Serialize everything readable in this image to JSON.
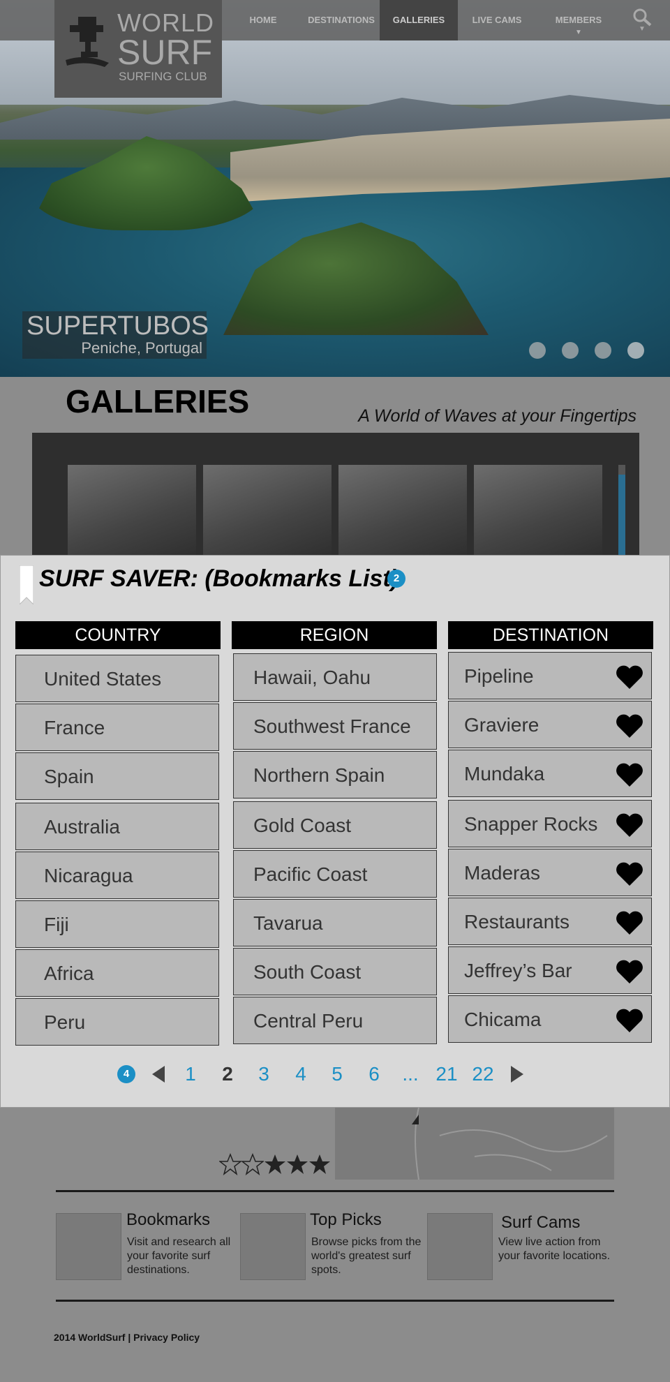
{
  "logo": {
    "line1": "WORLD",
    "line2": "SURF",
    "line3": "SURFING CLUB"
  },
  "nav": {
    "items": [
      {
        "label": "HOME",
        "active": false,
        "dropdown": false
      },
      {
        "label": "DESTINATIONS",
        "active": false,
        "dropdown": false
      },
      {
        "label": "GALLERIES",
        "active": true,
        "dropdown": false
      },
      {
        "label": "LIVE CAMS",
        "active": false,
        "dropdown": false
      },
      {
        "label": "MEMBERS",
        "active": false,
        "dropdown": true
      }
    ],
    "search_icon": "search-icon"
  },
  "hero": {
    "title": "SUPERTUBOS",
    "subtitle": "Peniche, Portugal",
    "slide_dots": 4
  },
  "galleries": {
    "title": "GALLERIES",
    "tagline": "A World of  Waves at your Fingertips"
  },
  "modal": {
    "title": "SURF SAVER: (Bookmarks List)",
    "title_badge": "2",
    "columns": [
      "COUNTRY",
      "REGION",
      "DESTINATION"
    ],
    "countries": [
      "United States",
      "France",
      "Spain",
      "Australia",
      "Nicaragua",
      "Fiji",
      "Africa",
      "Peru"
    ],
    "regions": [
      "Hawaii, Oahu",
      "Southwest France",
      "Northern Spain",
      "Gold Coast",
      "Pacific Coast",
      "Tavarua",
      "South Coast",
      "Central Peru"
    ],
    "destinations": [
      "Pipeline",
      "Graviere",
      "Mundaka",
      "Snapper Rocks",
      "Maderas",
      "Restaurants",
      "Jeffrey’s Bar",
      "Chicama"
    ],
    "pager": {
      "badge": "4",
      "pages": [
        "1",
        "2",
        "3",
        "4",
        "5",
        "6",
        "...",
        "21",
        "22"
      ],
      "current": "2"
    }
  },
  "rating": {
    "stars_filled": 3,
    "stars_total": 5
  },
  "features": [
    {
      "title": "Bookmarks",
      "text": "Visit and research all your favorite surf destinations."
    },
    {
      "title": "Top Picks",
      "text": "Browse picks from the world's greatest surf spots."
    },
    {
      "title": "Surf Cams",
      "text": "View live action from your favorite locations."
    }
  ],
  "footer": {
    "text": "2014 WorldSurf | Privacy Policy"
  },
  "colors": {
    "accent": "#1b8fc5",
    "header_bg": "#000000",
    "cell_bg": "#b9b9b9",
    "modal_bg": "#d9d9d9"
  }
}
